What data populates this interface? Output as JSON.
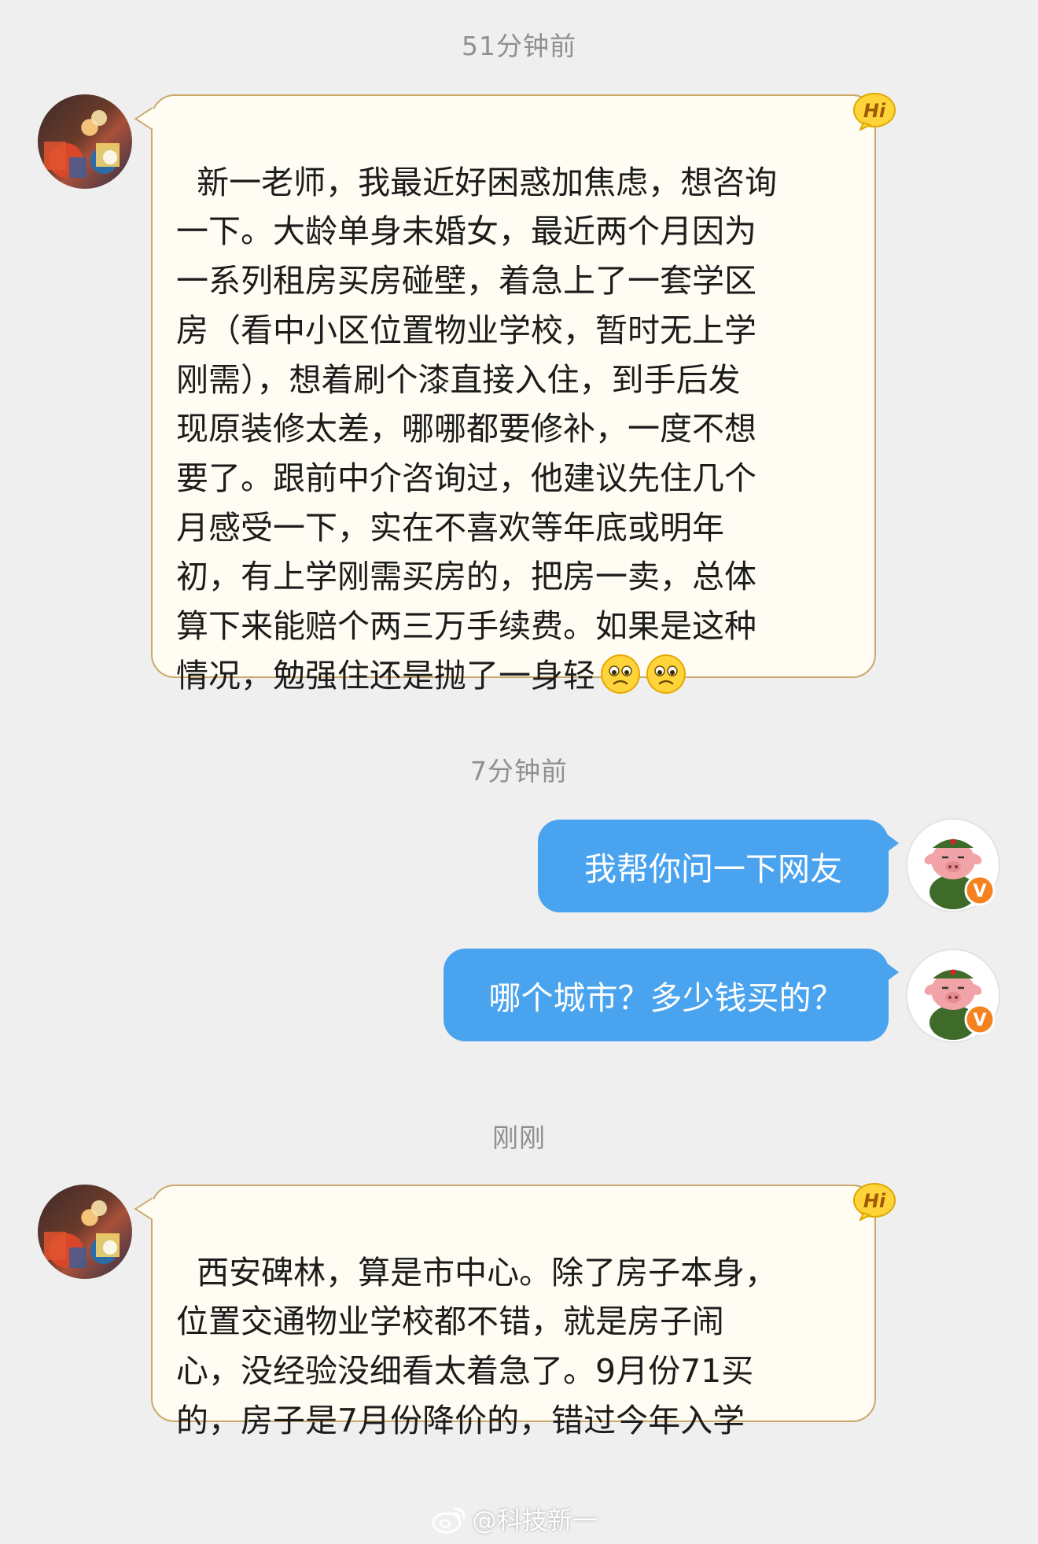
{
  "conversation": {
    "timestamps": [
      "51分钟前",
      "7分钟前",
      "刚刚"
    ],
    "messages": [
      {
        "from": "other",
        "text": "新一老师，我最近好困惑加焦虑，想咨询\n一下。大龄单身未婚女，最近两个月因为\n一系列租房买房碰壁，着急上了一套学区\n房（看中小区位置物业学校，暂时无上学\n刚需），想着刷个漆直接入住，到手后发\n现原装修太差，哪哪都要修补，一度不想\n要了。跟前中介咨询过，他建议先住几个\n月感受一下，实在不喜欢等年底或明年\n初，有上学刚需买房的，把房一卖，总体\n算下来能赔个两三万手续费。如果是这种\n情况，勉强住还是抛了一身轻",
        "trailing_icons": [
          "sad-face-icon",
          "sad-face-icon"
        ]
      },
      {
        "from": "me",
        "text": "我帮你问一下网友"
      },
      {
        "from": "me",
        "text": "哪个城市？多少钱买的？"
      },
      {
        "from": "other",
        "text": "西安碑林，算是市中心。除了房子本身，\n位置交通物业学校都不错，就是房子闹\n心，没经验没细看太着急了。9月份71买\n的，房子是7月份降价的，错过今年入学"
      }
    ],
    "badges": {
      "hi_label": "Hi",
      "verified_label": "V"
    }
  },
  "watermark": {
    "text": "@科技新一"
  },
  "colors": {
    "background": "#efefef",
    "incoming_bubble": "#fffdf3",
    "incoming_border": "#c9a96a",
    "outgoing_bubble": "#4aa3ee",
    "timestamp": "#8f8f8f",
    "verified_badge": "#f5821f"
  }
}
